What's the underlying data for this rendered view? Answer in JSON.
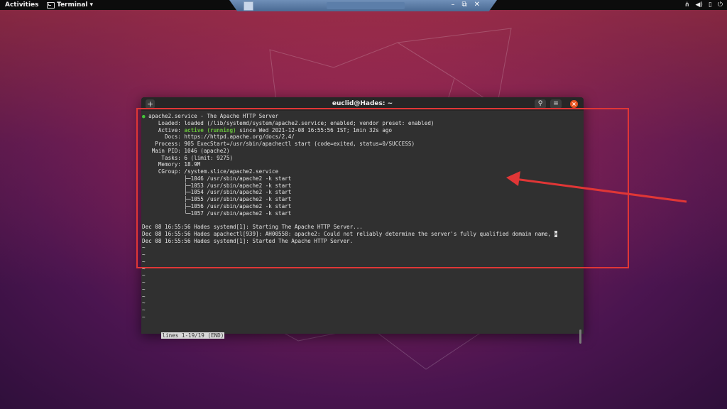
{
  "topbar": {
    "activities": "Activities",
    "app_menu": "Terminal",
    "tray_icons": [
      "network-icon",
      "volume-icon",
      "battery-icon",
      "power-icon"
    ]
  },
  "vm_toolbar": {
    "buttons": [
      "minimize-icon",
      "restore-icon",
      "close-icon"
    ]
  },
  "window": {
    "title": "euclid@Hades: ~"
  },
  "terminal": {
    "lines": [
      {
        "text": "apache2.service - The Apache HTTP Server",
        "kind": "service"
      },
      {
        "text": "     Loaded: loaded (/lib/systemd/system/apache2.service; enabled; vendor preset: enabled)",
        "kind": "plain"
      },
      {
        "prefix": "     Active: ",
        "status": "active (running)",
        "suffix": " since Wed 2021-12-08 16:55:56 IST; 1min 32s ago",
        "kind": "active"
      },
      {
        "text": "       Docs: https://httpd.apache.org/docs/2.4/",
        "kind": "plain"
      },
      {
        "text": "    Process: 905 ExecStart=/usr/sbin/apachectl start (code=exited, status=0/SUCCESS)",
        "kind": "plain"
      },
      {
        "text": "   Main PID: 1046 (apache2)",
        "kind": "plain"
      },
      {
        "text": "      Tasks: 6 (limit: 9275)",
        "kind": "plain"
      },
      {
        "text": "     Memory: 18.9M",
        "kind": "plain"
      },
      {
        "text": "     CGroup: /system.slice/apache2.service",
        "kind": "plain"
      },
      {
        "text": "             ├─1046 /usr/sbin/apache2 -k start",
        "kind": "plain"
      },
      {
        "text": "             ├─1053 /usr/sbin/apache2 -k start",
        "kind": "plain"
      },
      {
        "text": "             ├─1054 /usr/sbin/apache2 -k start",
        "kind": "plain"
      },
      {
        "text": "             ├─1055 /usr/sbin/apache2 -k start",
        "kind": "plain"
      },
      {
        "text": "             ├─1056 /usr/sbin/apache2 -k start",
        "kind": "plain"
      },
      {
        "text": "             └─1057 /usr/sbin/apache2 -k start",
        "kind": "plain"
      },
      {
        "text": "",
        "kind": "blank"
      },
      {
        "text": "Dec 08 16:55:56 Hades systemd[1]: Starting The Apache HTTP Server...",
        "kind": "plain"
      },
      {
        "text": "Dec 08 16:55:56 Hades apachectl[939]: AH00558: apache2: Could not reliably determine the server's fully qualified domain name, ",
        "kind": "cursor",
        "cursor": ">"
      },
      {
        "text": "Dec 08 16:55:56 Hades systemd[1]: Started The Apache HTTP Server.",
        "kind": "plain"
      },
      {
        "text": "~",
        "kind": "tilde"
      },
      {
        "text": "~",
        "kind": "tilde"
      },
      {
        "text": "~",
        "kind": "tilde"
      },
      {
        "text": "~",
        "kind": "tilde"
      },
      {
        "text": "~",
        "kind": "tilde"
      },
      {
        "text": "~",
        "kind": "tilde"
      },
      {
        "text": "~",
        "kind": "tilde"
      },
      {
        "text": "~",
        "kind": "tilde"
      },
      {
        "text": "~",
        "kind": "tilde"
      },
      {
        "text": "~",
        "kind": "tilde"
      },
      {
        "text": "~",
        "kind": "tilde"
      }
    ],
    "status_line": "lines 1-19/19 (END)",
    "service_dot": "●"
  },
  "colors": {
    "terminal_bg": "#303030",
    "titlebar_bg": "#262626",
    "active_green": "#68c33a",
    "annotation_red": "#e03636",
    "close_orange": "#e95420"
  }
}
